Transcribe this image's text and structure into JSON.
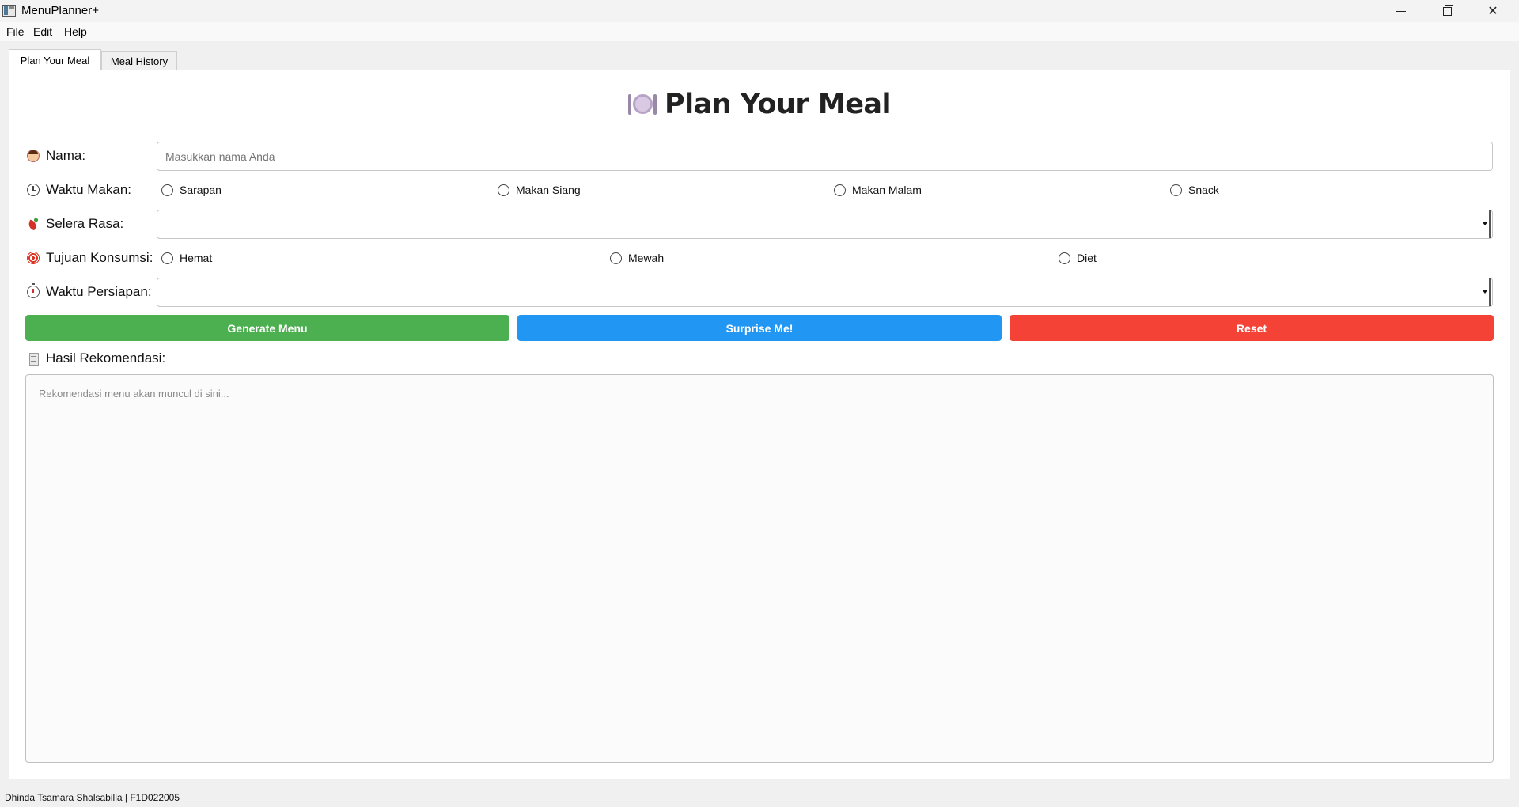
{
  "window": {
    "title": "MenuPlanner+"
  },
  "menu": [
    "File",
    "Edit",
    "Help"
  ],
  "tabs": [
    {
      "label": "Plan Your Meal",
      "active": true
    },
    {
      "label": "Meal History",
      "active": false
    }
  ],
  "page_title": "Plan Your Meal",
  "form": {
    "nama": {
      "label": "Nama:",
      "placeholder": "Masukkan nama Anda",
      "icon": "person-icon"
    },
    "waktu_makan": {
      "label": "Waktu Makan:",
      "icon": "clock-icon",
      "options": [
        "Sarapan",
        "Makan Siang",
        "Makan Malam",
        "Snack"
      ]
    },
    "selera_rasa": {
      "label": "Selera Rasa:",
      "icon": "chili-icon",
      "value": ""
    },
    "tujuan_konsumsi": {
      "label": "Tujuan Konsumsi:",
      "icon": "target-icon",
      "options": [
        "Hemat",
        "Mewah",
        "Diet"
      ]
    },
    "waktu_persiapan": {
      "label": "Waktu Persiapan:",
      "icon": "stopwatch-icon",
      "value": ""
    }
  },
  "buttons": {
    "generate": "Generate Menu",
    "surprise": "Surprise Me!",
    "reset": "Reset"
  },
  "colors": {
    "generate": "#4caf50",
    "surprise": "#2196f3",
    "reset": "#f44336"
  },
  "result": {
    "label": "Hasil Rekomendasi:",
    "placeholder": "Rekomendasi menu akan muncul di sini..."
  },
  "status": "Dhinda Tsamara Shalsabilla | F1D022005"
}
